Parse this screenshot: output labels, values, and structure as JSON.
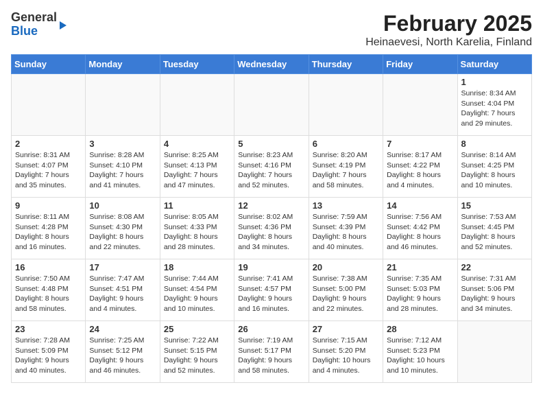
{
  "header": {
    "logo_general": "General",
    "logo_blue": "Blue",
    "title": "February 2025",
    "subtitle": "Heinaevesi, North Karelia, Finland"
  },
  "weekdays": [
    "Sunday",
    "Monday",
    "Tuesday",
    "Wednesday",
    "Thursday",
    "Friday",
    "Saturday"
  ],
  "weeks": [
    [
      {
        "day": "",
        "info": ""
      },
      {
        "day": "",
        "info": ""
      },
      {
        "day": "",
        "info": ""
      },
      {
        "day": "",
        "info": ""
      },
      {
        "day": "",
        "info": ""
      },
      {
        "day": "",
        "info": ""
      },
      {
        "day": "1",
        "info": "Sunrise: 8:34 AM\nSunset: 4:04 PM\nDaylight: 7 hours\nand 29 minutes."
      }
    ],
    [
      {
        "day": "2",
        "info": "Sunrise: 8:31 AM\nSunset: 4:07 PM\nDaylight: 7 hours\nand 35 minutes."
      },
      {
        "day": "3",
        "info": "Sunrise: 8:28 AM\nSunset: 4:10 PM\nDaylight: 7 hours\nand 41 minutes."
      },
      {
        "day": "4",
        "info": "Sunrise: 8:25 AM\nSunset: 4:13 PM\nDaylight: 7 hours\nand 47 minutes."
      },
      {
        "day": "5",
        "info": "Sunrise: 8:23 AM\nSunset: 4:16 PM\nDaylight: 7 hours\nand 52 minutes."
      },
      {
        "day": "6",
        "info": "Sunrise: 8:20 AM\nSunset: 4:19 PM\nDaylight: 7 hours\nand 58 minutes."
      },
      {
        "day": "7",
        "info": "Sunrise: 8:17 AM\nSunset: 4:22 PM\nDaylight: 8 hours\nand 4 minutes."
      },
      {
        "day": "8",
        "info": "Sunrise: 8:14 AM\nSunset: 4:25 PM\nDaylight: 8 hours\nand 10 minutes."
      }
    ],
    [
      {
        "day": "9",
        "info": "Sunrise: 8:11 AM\nSunset: 4:28 PM\nDaylight: 8 hours\nand 16 minutes."
      },
      {
        "day": "10",
        "info": "Sunrise: 8:08 AM\nSunset: 4:30 PM\nDaylight: 8 hours\nand 22 minutes."
      },
      {
        "day": "11",
        "info": "Sunrise: 8:05 AM\nSunset: 4:33 PM\nDaylight: 8 hours\nand 28 minutes."
      },
      {
        "day": "12",
        "info": "Sunrise: 8:02 AM\nSunset: 4:36 PM\nDaylight: 8 hours\nand 34 minutes."
      },
      {
        "day": "13",
        "info": "Sunrise: 7:59 AM\nSunset: 4:39 PM\nDaylight: 8 hours\nand 40 minutes."
      },
      {
        "day": "14",
        "info": "Sunrise: 7:56 AM\nSunset: 4:42 PM\nDaylight: 8 hours\nand 46 minutes."
      },
      {
        "day": "15",
        "info": "Sunrise: 7:53 AM\nSunset: 4:45 PM\nDaylight: 8 hours\nand 52 minutes."
      }
    ],
    [
      {
        "day": "16",
        "info": "Sunrise: 7:50 AM\nSunset: 4:48 PM\nDaylight: 8 hours\nand 58 minutes."
      },
      {
        "day": "17",
        "info": "Sunrise: 7:47 AM\nSunset: 4:51 PM\nDaylight: 9 hours\nand 4 minutes."
      },
      {
        "day": "18",
        "info": "Sunrise: 7:44 AM\nSunset: 4:54 PM\nDaylight: 9 hours\nand 10 minutes."
      },
      {
        "day": "19",
        "info": "Sunrise: 7:41 AM\nSunset: 4:57 PM\nDaylight: 9 hours\nand 16 minutes."
      },
      {
        "day": "20",
        "info": "Sunrise: 7:38 AM\nSunset: 5:00 PM\nDaylight: 9 hours\nand 22 minutes."
      },
      {
        "day": "21",
        "info": "Sunrise: 7:35 AM\nSunset: 5:03 PM\nDaylight: 9 hours\nand 28 minutes."
      },
      {
        "day": "22",
        "info": "Sunrise: 7:31 AM\nSunset: 5:06 PM\nDaylight: 9 hours\nand 34 minutes."
      }
    ],
    [
      {
        "day": "23",
        "info": "Sunrise: 7:28 AM\nSunset: 5:09 PM\nDaylight: 9 hours\nand 40 minutes."
      },
      {
        "day": "24",
        "info": "Sunrise: 7:25 AM\nSunset: 5:12 PM\nDaylight: 9 hours\nand 46 minutes."
      },
      {
        "day": "25",
        "info": "Sunrise: 7:22 AM\nSunset: 5:15 PM\nDaylight: 9 hours\nand 52 minutes."
      },
      {
        "day": "26",
        "info": "Sunrise: 7:19 AM\nSunset: 5:17 PM\nDaylight: 9 hours\nand 58 minutes."
      },
      {
        "day": "27",
        "info": "Sunrise: 7:15 AM\nSunset: 5:20 PM\nDaylight: 10 hours\nand 4 minutes."
      },
      {
        "day": "28",
        "info": "Sunrise: 7:12 AM\nSunset: 5:23 PM\nDaylight: 10 hours\nand 10 minutes."
      },
      {
        "day": "",
        "info": ""
      }
    ]
  ]
}
